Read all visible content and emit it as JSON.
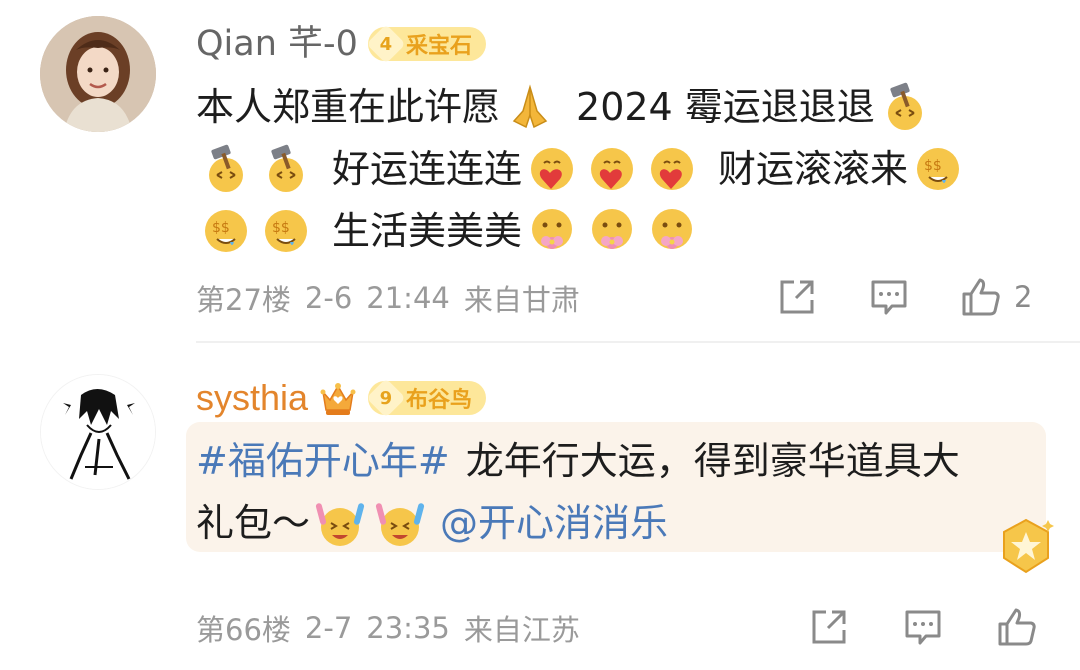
{
  "comments": [
    {
      "username": "Qian 芊-0",
      "badge": {
        "level": "4",
        "label": "采宝石"
      },
      "lines": [
        [
          "本人郑重在此许愿",
          "2024 霉运退退退"
        ],
        [
          "好运连连连",
          "财运滚滚来"
        ],
        [
          "生活美美美"
        ]
      ],
      "floor": "第27楼",
      "date": "2-6",
      "time": "21:44",
      "location": "来自甘肃",
      "like_count": "2"
    },
    {
      "username": "systhia",
      "badge": {
        "level": "9",
        "label": "布谷鸟"
      },
      "topic": "#福佑开心年#",
      "text_1": "龙年行大运，得到豪华道具大",
      "text_2": "礼包～",
      "mention": "@开心消消乐",
      "floor": "第66楼",
      "date": "2-7",
      "time": "23:35",
      "location": "来自江苏",
      "like_count": ""
    }
  ],
  "icons": {
    "share": "share-icon",
    "comment": "comment-icon",
    "like": "like-icon"
  },
  "colors": {
    "link": "#4a79b8",
    "vip_name": "#e3852c",
    "meta": "#9a9a9a",
    "badge_bg": "#fde79a"
  }
}
